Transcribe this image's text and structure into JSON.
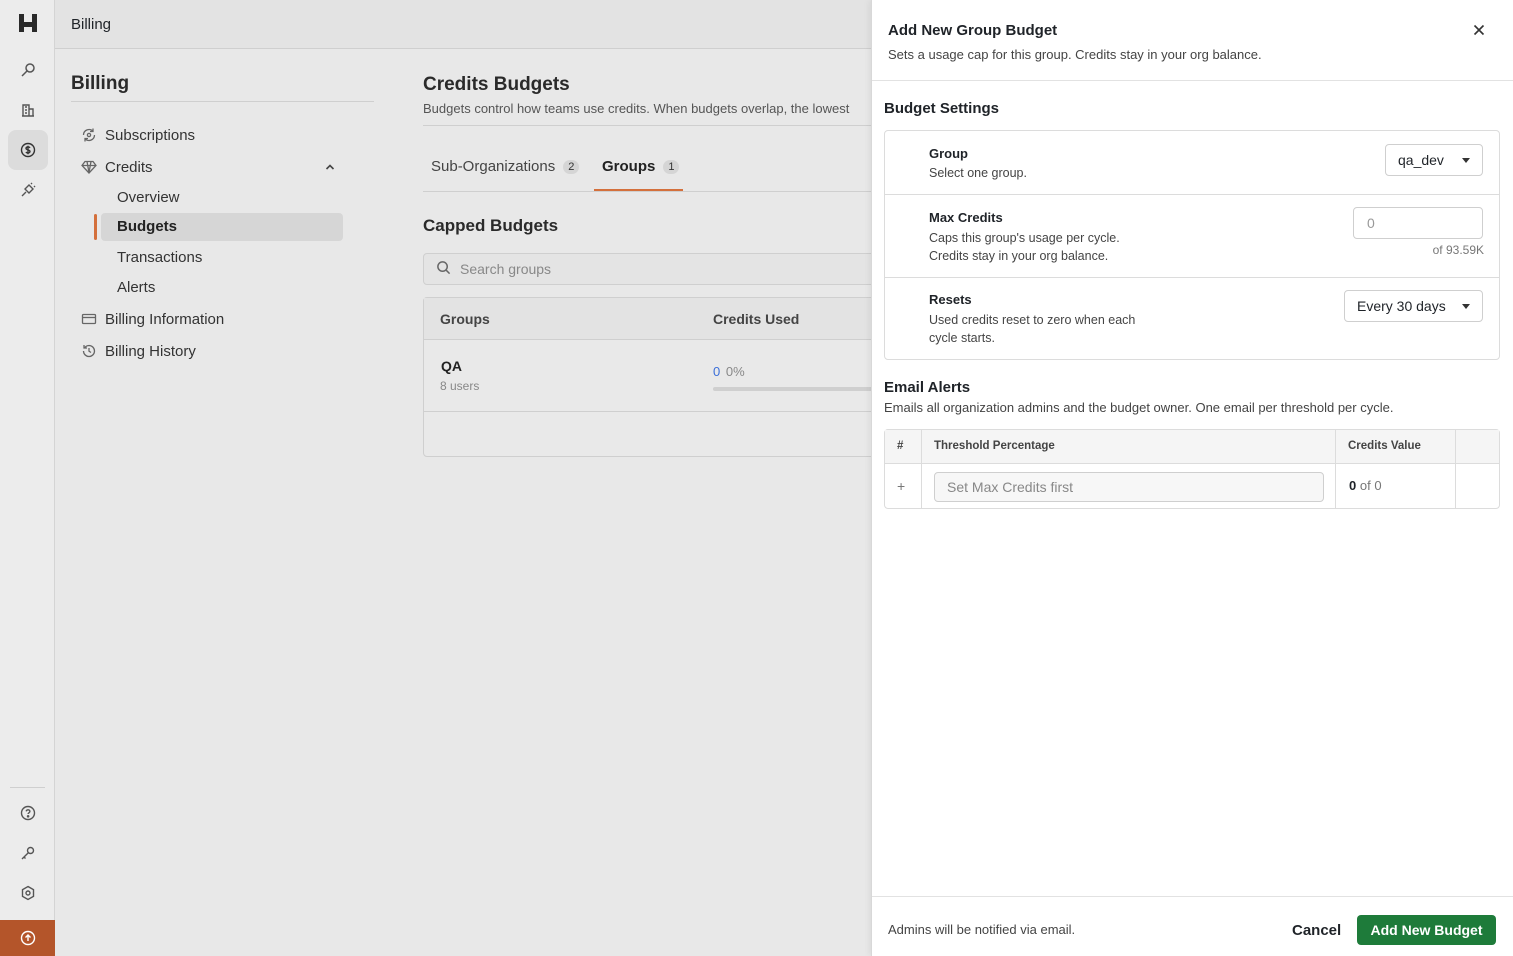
{
  "topbar": {
    "title": "Billing"
  },
  "sidebar": {
    "title": "Billing",
    "items": [
      {
        "label": "Subscriptions",
        "icon": "subscriptions-icon"
      },
      {
        "label": "Credits",
        "icon": "gem-icon"
      },
      {
        "label": "Billing Information",
        "icon": "credit-card-icon"
      },
      {
        "label": "Billing History",
        "icon": "history-icon"
      }
    ],
    "credits_sub": [
      {
        "label": "Overview"
      },
      {
        "label": "Budgets",
        "active": true
      },
      {
        "label": "Transactions"
      },
      {
        "label": "Alerts"
      }
    ]
  },
  "main": {
    "title": "Credits Budgets",
    "description": "Budgets control how teams use credits. When budgets overlap, the lowest",
    "tabs": [
      {
        "label": "Sub-Organizations",
        "count": "2"
      },
      {
        "label": "Groups",
        "count": "1",
        "active": true
      }
    ],
    "section_title": "Capped Budgets",
    "search_placeholder": "Search groups",
    "table": {
      "headers": [
        "Groups",
        "Credits Used"
      ],
      "rows": [
        {
          "name": "QA",
          "users": "8 users",
          "used": "0",
          "percent": "0%",
          "progress": 0
        }
      ]
    }
  },
  "panel": {
    "title": "Add New Group Budget",
    "subtitle": "Sets a usage cap for this group. Credits stay in your org balance.",
    "settings_title": "Budget Settings",
    "group": {
      "label": "Group",
      "hint": "Select one group.",
      "value": "qa_dev"
    },
    "max_credits": {
      "label": "Max Credits",
      "hint_line1": "Caps this group's usage per cycle.",
      "hint_line2": "Credits stay in your org balance.",
      "placeholder": "0",
      "of_total": "of 93.59K"
    },
    "resets": {
      "label": "Resets",
      "hint_line1": "Used credits reset to zero when each",
      "hint_line2": "cycle starts.",
      "value": "Every 30 days"
    },
    "alerts_title": "Email Alerts",
    "alerts_subtitle": "Emails all organization admins and the budget owner. One email per threshold per cycle.",
    "alerts_table": {
      "headers": [
        "#",
        "Threshold Percentage",
        "Credits Value"
      ],
      "row": {
        "add": "+",
        "placeholder": "Set Max Credits first",
        "credits_value": "0",
        "credits_of": "of 0"
      }
    },
    "footer": {
      "note": "Admins will be notified via email.",
      "cancel": "Cancel",
      "submit": "Add New Budget"
    }
  },
  "colors": {
    "accent_orange": "#d4703c",
    "primary_green": "#1e7b3a",
    "link_blue": "#3b6fd9",
    "rail_bottom": "#b4552a"
  }
}
